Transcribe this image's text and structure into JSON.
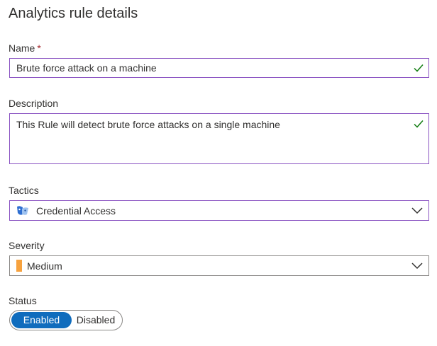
{
  "title": "Analytics rule details",
  "name": {
    "label": "Name",
    "required_mark": "*",
    "value": "Brute force attack on a machine"
  },
  "description": {
    "label": "Description",
    "value": "This Rule will detect brute force attacks on a single machine"
  },
  "tactics": {
    "label": "Tactics",
    "value": "Credential Access",
    "icon": "mask-icon"
  },
  "severity": {
    "label": "Severity",
    "value": "Medium",
    "color": "#f7a23e"
  },
  "status": {
    "label": "Status",
    "options": [
      "Enabled",
      "Disabled"
    ],
    "selected": "Enabled"
  },
  "colors": {
    "active_border": "#8a53c2",
    "check": "#107c10",
    "toggle_on": "#0f6cbd"
  }
}
